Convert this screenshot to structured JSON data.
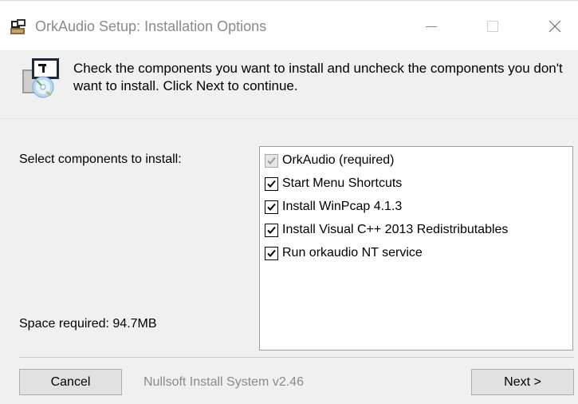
{
  "window": {
    "title": "OrkAudio Setup: Installation Options",
    "icons": {
      "app": "installer-app-icon",
      "minimize": "minimize-icon",
      "maximize": "maximize-icon",
      "close": "close-icon"
    }
  },
  "header": {
    "icon": "installer-cd-icon",
    "text": "Check the components you want to install and uncheck the components you don't want to install. Click Next to continue."
  },
  "labels": {
    "select_components": "Select components to install:",
    "space_required": "Space required: 94.7MB"
  },
  "components": [
    {
      "label": "OrkAudio (required)",
      "checked": true,
      "disabled": true
    },
    {
      "label": "Start Menu Shortcuts",
      "checked": true,
      "disabled": false
    },
    {
      "label": "Install WinPcap 4.1.3",
      "checked": true,
      "disabled": false
    },
    {
      "label": "Install Visual C++ 2013 Redistributables",
      "checked": true,
      "disabled": false
    },
    {
      "label": "Run orkaudio NT service",
      "checked": true,
      "disabled": false
    }
  ],
  "footer": {
    "cancel_label": "Cancel",
    "branding": "Nullsoft Install System v2.46",
    "next_label": "Next >"
  }
}
